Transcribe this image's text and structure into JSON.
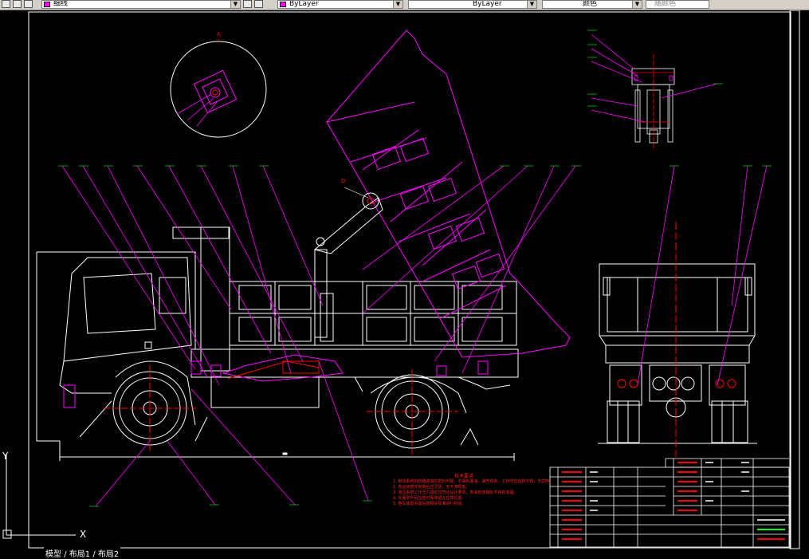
{
  "toolbar": {
    "layer_combo": "细线",
    "color_combo": "ByLayer",
    "linetype_combo": "ByLayer",
    "lineweight_combo": "颜色",
    "plotstyle_combo": "随颜色"
  },
  "drawing": {
    "section_label_a": "A",
    "section_label_d": "D",
    "tech_requirements_title": "技术要求",
    "tech_requirements": [
      "1. 制动系统的管路连接应密封可靠，不得有漏油、漏气现象，工作时应运转平稳，无异响。",
      "2. 各运动部件安装后应灵活，无卡滞现象。",
      "3. 液压系统工作压力调定应符合设计要求，各油管连接处不得有渗漏。",
      "4. 车厢举升后应能可靠停留在任意位置。",
      "5. 整车装配完成后按相关标准进行检验。"
    ]
  },
  "ucs": {
    "x_label": "X",
    "y_label": "Y"
  },
  "layout_tabs": [
    "模型",
    "布局1",
    "布局2"
  ],
  "colors": {
    "background": "#000000",
    "magenta": "#ff00ff",
    "white": "#ffffff",
    "red": "#ff0000",
    "green": "#00ff00",
    "toolbar": "#d4d0c8"
  }
}
